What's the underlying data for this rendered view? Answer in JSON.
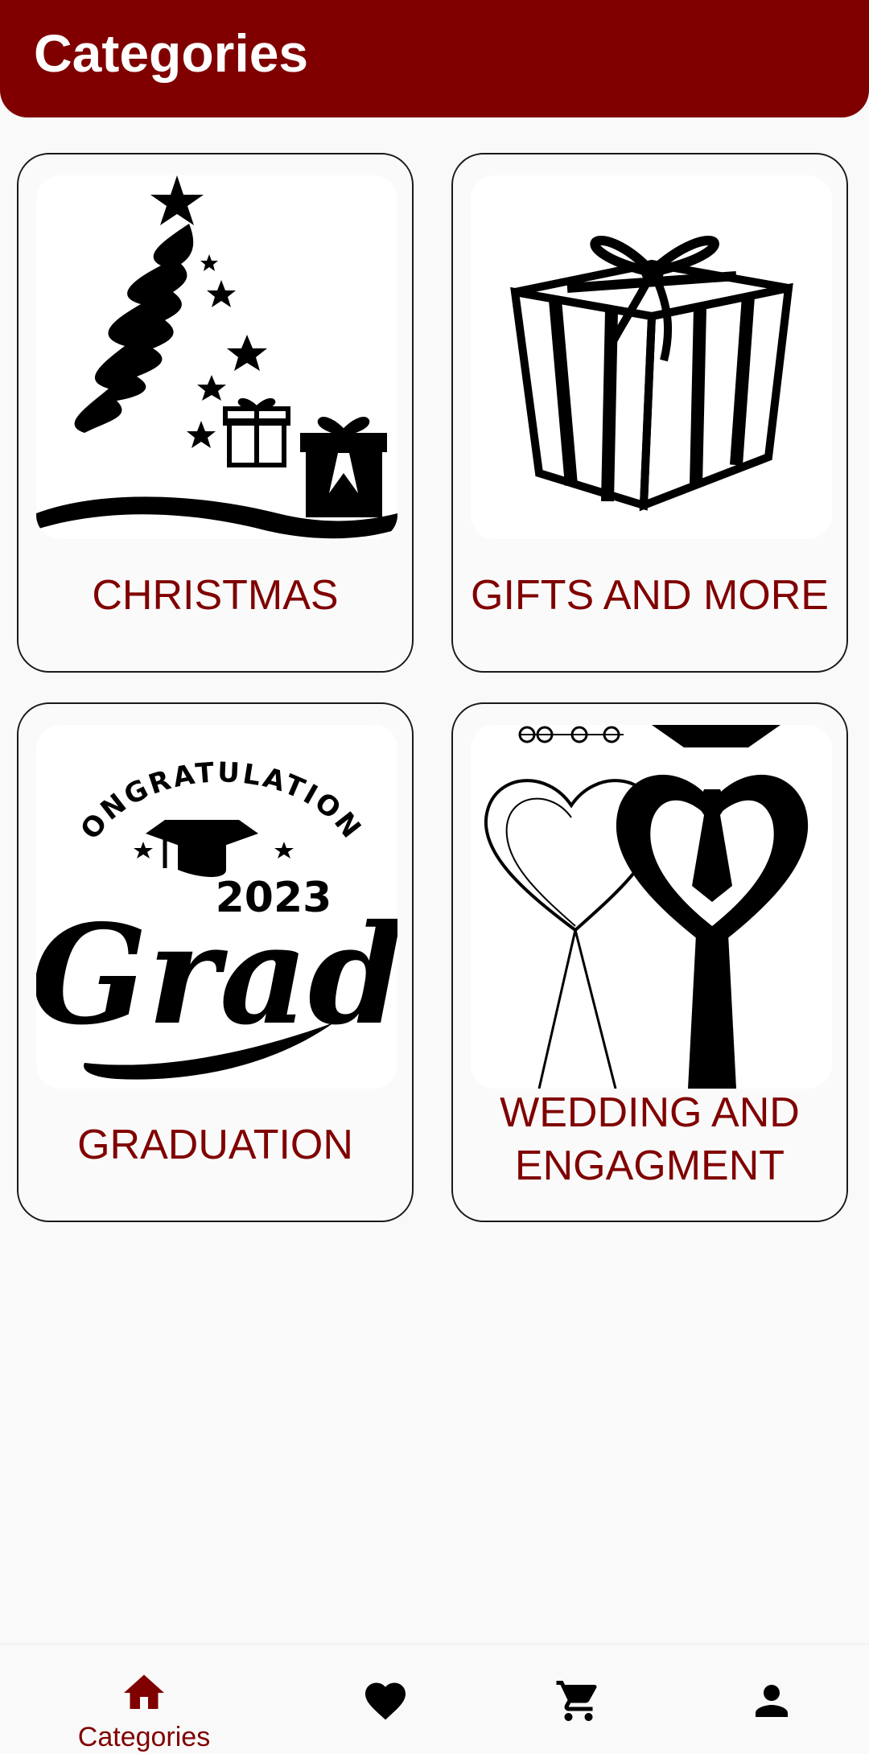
{
  "app_bar": {
    "title": "Categories"
  },
  "categories": [
    {
      "label": "CHRISTMAS",
      "icon": "christmas-tree-icon"
    },
    {
      "label": "GIFTS AND MORE",
      "icon": "gift-box-icon"
    },
    {
      "label": "GRADUATION",
      "icon": "graduation-icon",
      "image_text": {
        "top": "CONGRATULATIONS",
        "year": "2023",
        "word": "Grad"
      }
    },
    {
      "label_line1": "WEDDING AND",
      "label_line2": "ENGAGMENT",
      "icon": "wedding-icon"
    }
  ],
  "bottom_nav": {
    "items": [
      {
        "label": "Categories",
        "icon": "home-icon",
        "active": true
      },
      {
        "icon": "heart-icon"
      },
      {
        "icon": "cart-icon"
      },
      {
        "icon": "person-icon"
      }
    ]
  },
  "colors": {
    "accent": "#800000",
    "background": "#f9f9f9",
    "icon": "#000000"
  }
}
